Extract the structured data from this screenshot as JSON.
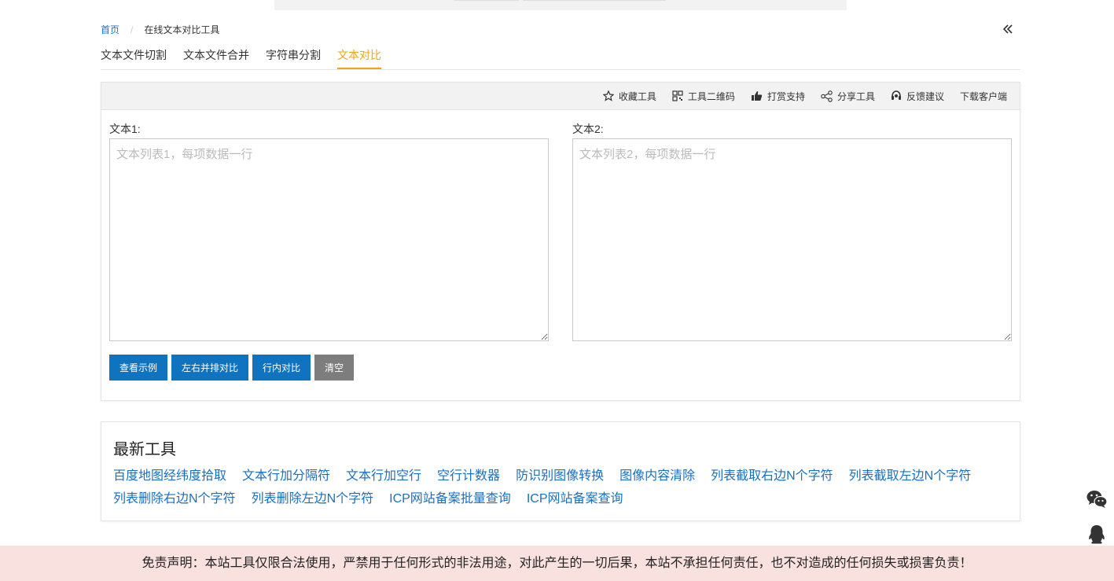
{
  "breadcrumb": {
    "home": "首页",
    "separator": "/",
    "current": "在线文本对比工具"
  },
  "collapse_icon": "double-chevron-left-icon",
  "tabs": [
    {
      "label": "文本文件切割",
      "active": false
    },
    {
      "label": "文本文件合并",
      "active": false
    },
    {
      "label": "字符串分割",
      "active": false
    },
    {
      "label": "文本对比",
      "active": true
    }
  ],
  "toolbar": {
    "favorite": "收藏工具",
    "qrcode": "工具二维码",
    "reward": "打赏支持",
    "share": "分享工具",
    "feedback": "反馈建议",
    "download": "下载客户端"
  },
  "form": {
    "text1_label": "文本1:",
    "text1_placeholder": "文本列表1，每项数据一行",
    "text2_label": "文本2:",
    "text2_placeholder": "文本列表2，每项数据一行",
    "buttons": {
      "example": "查看示例",
      "side_by_side": "左右并排对比",
      "inline": "行内对比",
      "clear": "清空"
    }
  },
  "latest": {
    "title": "最新工具",
    "links": [
      "百度地图经纬度拾取",
      "文本行加分隔符",
      "文本行加空行",
      "空行计数器",
      "防识别图像转换",
      "图像内容清除",
      "列表截取右边N个字符",
      "列表截取左边N个字符",
      "列表删除右边N个字符",
      "列表删除左边N个字符",
      "ICP网站备案批量查询",
      "ICP网站备案查询"
    ]
  },
  "disclaimer": "免责声明：本站工具仅限合法使用，严禁用于任何形式的非法用途，对此产生的一切后果，本站不承担任何责任，也不对造成的任何损失或损害负责！",
  "colors": {
    "accent": "#f0a31a",
    "primary_button": "#0f73c0",
    "clear_button": "#7d7d7d",
    "link": "#1a6fc0",
    "disclaimer_bg": "#f8e1df"
  }
}
